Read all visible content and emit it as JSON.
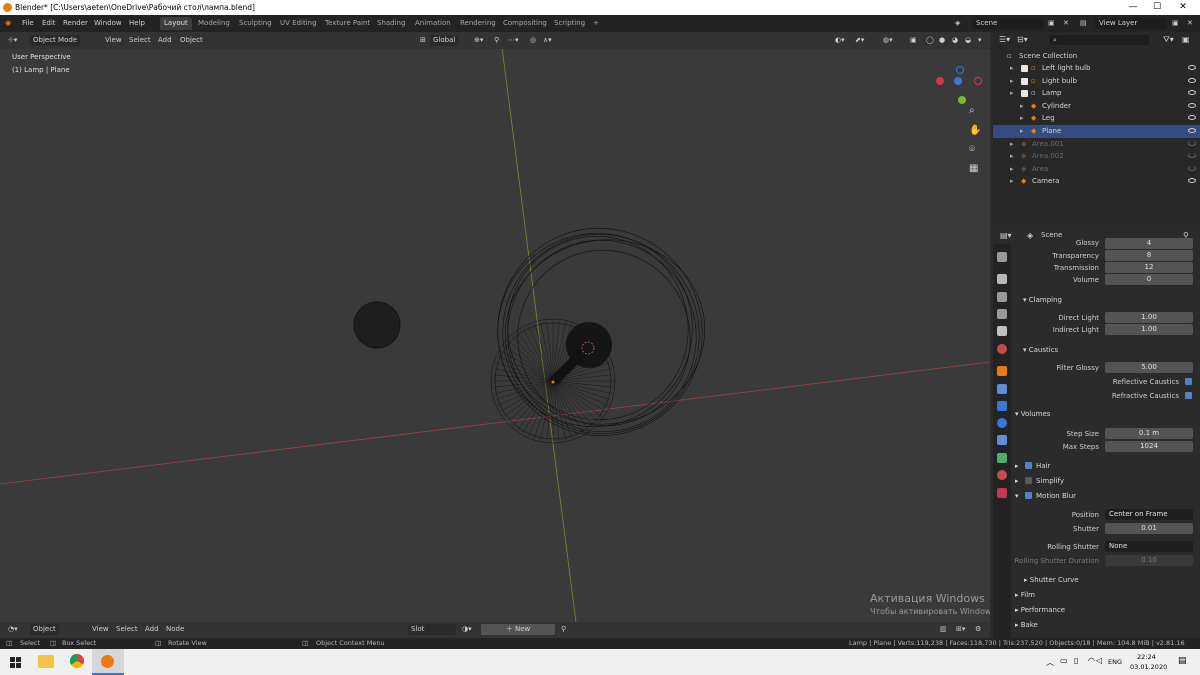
{
  "window": {
    "title": "Blender* [C:\\Users\\aeten\\OneDrive\\Рабочий стол\\лампа.blend]",
    "min": "—",
    "max": "☐",
    "close": "✕"
  },
  "menu": {
    "items": [
      "File",
      "Edit",
      "Render",
      "Window",
      "Help"
    ]
  },
  "workspaces": [
    "Layout",
    "Modeling",
    "Sculpting",
    "UV Editing",
    "Texture Paint",
    "Shading",
    "Animation",
    "Rendering",
    "Compositing",
    "Scripting",
    "+"
  ],
  "scene": {
    "name": "Scene",
    "view_layer": "View Layer"
  },
  "viewport": {
    "mode": "Object Mode",
    "menus": [
      "View",
      "Select",
      "Add",
      "Object"
    ],
    "transform": "Global",
    "overlay_title": "User Perspective",
    "overlay_sub": "(1) Lamp | Plane"
  },
  "outliner": {
    "search_placeholder": "",
    "title": "Scene Collection",
    "rows": [
      {
        "label": "Left light bulb",
        "indent": 1,
        "checked": true,
        "dim": false
      },
      {
        "label": "Light bulb",
        "indent": 1,
        "checked": true,
        "dim": false
      },
      {
        "label": "Lamp",
        "indent": 1,
        "checked": true,
        "dim": false
      },
      {
        "label": "Cylinder",
        "indent": 2,
        "checked": false,
        "dim": false
      },
      {
        "label": "Leg",
        "indent": 2,
        "checked": false,
        "dim": false
      },
      {
        "label": "Plane",
        "indent": 2,
        "checked": false,
        "dim": false
      },
      {
        "label": "Area.001",
        "indent": 1,
        "checked": false,
        "dim": true
      },
      {
        "label": "Area.002",
        "indent": 1,
        "checked": false,
        "dim": true
      },
      {
        "label": "Area",
        "indent": 1,
        "checked": false,
        "dim": true
      },
      {
        "label": "Camera",
        "indent": 1,
        "checked": false,
        "dim": false
      }
    ]
  },
  "properties": {
    "context": "Scene",
    "glossy_label": "Glossy",
    "glossy_val": "4",
    "transparency_label": "Transparency",
    "transparency_val": "8",
    "transmission_label": "Transmission",
    "transmission_val": "12",
    "volume_label": "Volume",
    "volume_val": "0",
    "clamping": "Clamping",
    "direct_label": "Direct Light",
    "direct_val": "1.00",
    "indirect_label": "Indirect Light",
    "indirect_val": "1.00",
    "caustics": "Caustics",
    "filter_label": "Filter Glossy",
    "filter_val": "5.00",
    "reflective": "Reflective Caustics",
    "refractive": "Refractive Caustics",
    "volumes": "Volumes",
    "step_label": "Step Size",
    "step_val": "0.1 m",
    "maxsteps_label": "Max Steps",
    "maxsteps_val": "1024",
    "hair": "Hair",
    "simplify": "Simplify",
    "motion_blur": "Motion Blur",
    "position_label": "Position",
    "position_val": "Center on Frame",
    "shutter_label": "Shutter",
    "shutter_val": "0.01",
    "rolling_label": "Rolling Shutter",
    "rolling_val": "None",
    "rolling_dur_label": "Rolling Shutter Duration",
    "rolling_dur_val": "0.10",
    "shutter_curve": "Shutter Curve",
    "film": "Film",
    "performance": "Performance",
    "bake": "Bake"
  },
  "timeline": {
    "mode": "Object",
    "menus": [
      "View",
      "Select",
      "Add",
      "Node"
    ],
    "slot": "Slot",
    "new": "New"
  },
  "statusbar": {
    "select": "Select",
    "box": "Box Select",
    "rotate": "Rotate View",
    "context": "Object Context Menu",
    "stats": "Lamp | Plane | Verts:119,238 | Faces:118,730 | Tris:237,520 | Objects:0/18 | Mem: 104.8 MiB | v2.81.16"
  },
  "watermark": {
    "line1": "Активация Windows",
    "line2": "Чтобы активировать Windows, перейдите в раздел \"Параметры\"."
  },
  "taskbar": {
    "lang": "ENG",
    "time": "22:24",
    "date": "03.01.2020"
  },
  "colors": {
    "accent": "#e87d0d",
    "checkbox": "#5680c2",
    "x_axis": "#c84b4b",
    "y_axis": "#8ab83a"
  }
}
